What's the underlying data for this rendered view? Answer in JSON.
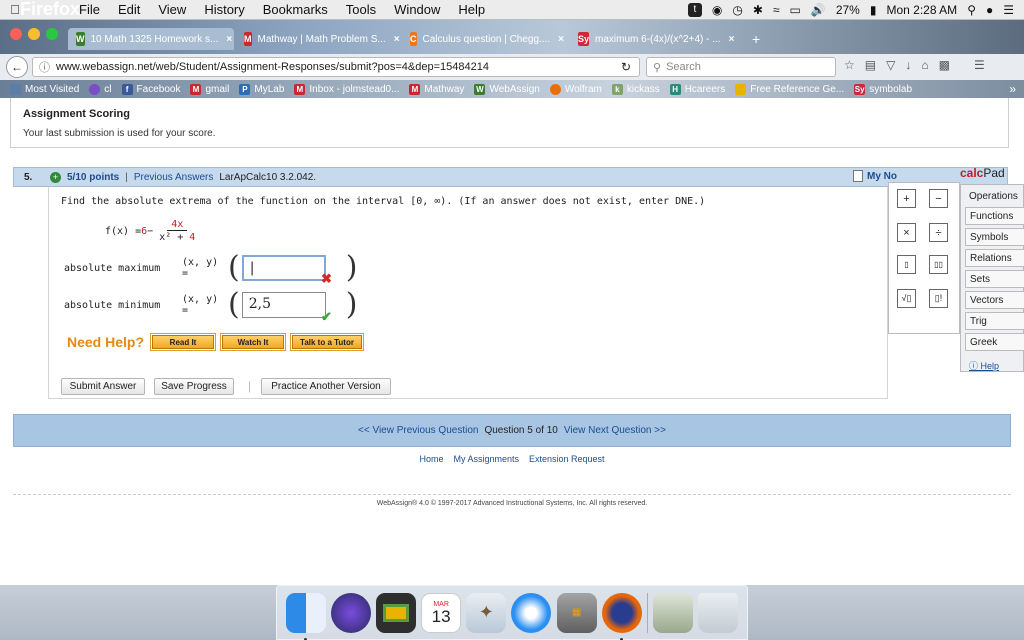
{
  "menubar": {
    "apple": "",
    "app": "Firefox",
    "items": [
      "File",
      "Edit",
      "View",
      "History",
      "Bookmarks",
      "Tools",
      "Window",
      "Help"
    ],
    "battery": "27%",
    "clock": "Mon 2:28 AM"
  },
  "tabs": [
    {
      "label": "10 Math 1325 Homework s...",
      "icon": "webassign-icon",
      "color": "#3a7d2c",
      "glyph": "W",
      "active": true
    },
    {
      "label": "Mathway | Math Problem S...",
      "icon": "mathway-icon",
      "color": "#c8282e",
      "glyph": "M"
    },
    {
      "label": "Calculus question | Chegg....",
      "icon": "chegg-icon",
      "color": "#e87722",
      "glyph": "C"
    },
    {
      "label": "maximum 6-(4x)/(x^2+4) - ...",
      "icon": "symbolab-icon",
      "color": "#d0283b",
      "glyph": "Sy"
    }
  ],
  "urlbar": {
    "url": "www.webassign.net/web/Student/Assignment-Responses/submit?pos=4&dep=15484214",
    "search_placeholder": "Search"
  },
  "bookmarks": [
    {
      "label": "Most Visited",
      "color": "#5b7ea8"
    },
    {
      "label": "cl",
      "color": "#7a4ec7"
    },
    {
      "label": "Facebook",
      "color": "#3b5998"
    },
    {
      "label": "gmail",
      "color": "#c8282e"
    },
    {
      "label": "MyLab",
      "color": "#2a6fb2"
    },
    {
      "label": "Inbox - jolmstead0...",
      "color": "#c8282e"
    },
    {
      "label": "Mathway",
      "color": "#c8282e"
    },
    {
      "label": "WebAssign",
      "color": "#3a7d2c"
    },
    {
      "label": "Wolfram",
      "color": "#e8700a"
    },
    {
      "label": "kickass",
      "color": "#7fa36b"
    },
    {
      "label": "Hcareers",
      "color": "#2b8a7a"
    },
    {
      "label": "Free Reference Ge...",
      "color": "#e8b400"
    },
    {
      "label": "symbolab",
      "color": "#d0283b"
    }
  ],
  "scoring": {
    "title": "Assignment Scoring",
    "text": "Your last submission is used for your score."
  },
  "question": {
    "number": "5.",
    "points": "5/10 points",
    "prev_answers": "Previous Answers",
    "source": "LarApCalc10 3.2.042.",
    "notes": "My No",
    "prompt": "Find the absolute extrema of the function on the interval [0, ∞). (If an answer does not exist, enter DNE.)",
    "func_lhs": "f(x) = ",
    "func_const": "6",
    "func_minus": " −",
    "func_num": "4x",
    "func_den_a": "x² + ",
    "func_den_b": "4",
    "max_label": "absolute maximum",
    "min_label": "absolute minimum",
    "xy_label": "(x, y) =",
    "max_value": "|",
    "min_value": "2,5",
    "max_status": "incorrect",
    "min_status": "correct"
  },
  "help": {
    "label": "Need Help?",
    "read": "Read It",
    "watch": "Watch It",
    "tutor": "Talk to a Tutor"
  },
  "actions": {
    "submit": "Submit Answer",
    "save": "Save Progress",
    "practice": "Practice Another Version"
  },
  "calcpad": {
    "title_a": "calc",
    "title_b": "Pad",
    "keys": [
      "+",
      "−",
      "×",
      "÷",
      "▯",
      "▯▯",
      "√▯",
      "▯!"
    ],
    "categories": [
      "Operations",
      "Functions",
      "Symbols",
      "Relations",
      "Sets",
      "Vectors",
      "Trig",
      "Greek"
    ],
    "help": "Help"
  },
  "nav": {
    "prev": "<< View Previous Question",
    "middle": "Question 5 of 10",
    "next": "View Next Question >>"
  },
  "links": [
    "Home",
    "My Assignments",
    "Extension Request"
  ],
  "footer": "WebAssign® 4.0 © 1997-2017 Advanced Instructional Systems, Inc. All rights reserved.",
  "dock": {
    "calendar_month": "MAR",
    "calendar_day": "13"
  }
}
